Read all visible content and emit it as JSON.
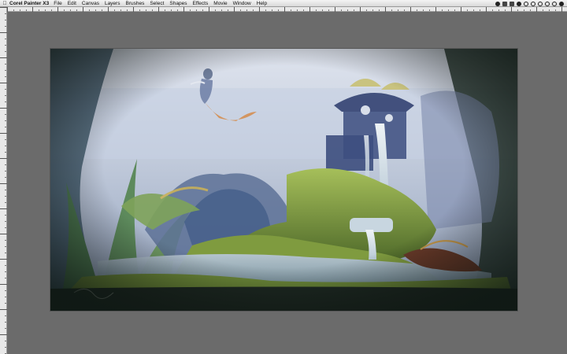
{
  "menubar": {
    "apple_icon": "apple-icon",
    "app_name": "Corel Painter X3",
    "items": [
      "File",
      "Edit",
      "Canvas",
      "Layers",
      "Brushes",
      "Select",
      "Shapes",
      "Effects",
      "Movie",
      "Window",
      "Help"
    ]
  },
  "status_icons": [
    "status-icon-1",
    "status-icon-2",
    "status-icon-3",
    "status-icon-4",
    "status-icon-5",
    "status-icon-6",
    "status-icon-7",
    "status-icon-8",
    "status-icon-9",
    "status-icon-10"
  ],
  "canvas": {
    "background_color": "#6b6b6b",
    "artwork_palette": {
      "sky": "#c9d2e0",
      "water": "#9fb3c3",
      "moss": "#7d9a3c",
      "shadow": "#2c3a34"
    }
  }
}
